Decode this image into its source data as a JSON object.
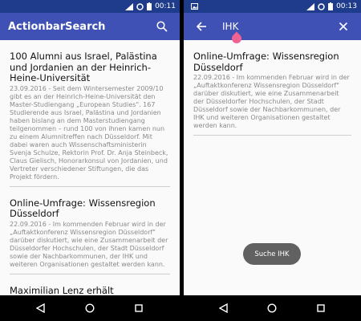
{
  "left": {
    "status": {
      "time": "00:11",
      "network": "4G"
    },
    "appbar": {
      "title": "ActionbarSearch",
      "search_icon": "search-icon"
    },
    "articles": [
      {
        "title": "100 Alumni aus Israel, Palästina und Jordanien an der Heinrich-Heine-Universität",
        "snippet": "23.09.2016 - Seit dem Wintersemester 2009/10 gibt es an der Heinrich-Heine-Universität den Master-Studiengang „European Studies\". 167 Studierende aus Israel, Palästina und Jordanien haben bislang an dem Masterstudiengang teilgenommen – rund 100 von ihnen kamen nun zu einem Alumnitreffen nach Düsseldorf. Mit dabei waren auch Wissenschaftsministerin Svenja Schulze, Rektorin Prof. Dr. Anja Steinbeck, Claus Gielisch, Honorarkonsul von Jordanien, und Vertreter verschiedener Stiftungen, die das Projekt fördern."
      },
      {
        "title": "Online-Umfrage: Wissensregion Düsseldorf",
        "snippet": "22.09.2016 - Im kommenden Februar wird in der „Auftaktkonferenz Wissensregion Düsseldorf\" darüber diskutiert, wie eine Zusammenarbeit der Düsseldorfer Hochschulen, der Stadt Düsseldorf sowie der Nachbarkommunen, der IHK und weiteren Organisationen gestaltet werden kann."
      },
      {
        "title": "Maximilian Lenz erhält Nachwuchspreis der Anatomischen",
        "snippet": ""
      }
    ]
  },
  "right": {
    "status": {
      "time": "00:13",
      "network": "4G"
    },
    "appbar": {
      "query": "IHK",
      "back_icon": "back-arrow-icon",
      "clear_icon": "close-icon"
    },
    "articles": [
      {
        "title": "Online-Umfrage: Wissensregion Düsseldorf",
        "snippet": "22.09.2016 - Im kommenden Februar wird in der „Auftaktkonferenz Wissensregion Düsseldorf\" darüber diskutiert, wie eine Zusammenarbeit der Düsseldorfer Hochschulen, der Stadt Düsseldorf sowie der Nachbarkommunen, der IHK und weiteren Organisationen gestaltet werden kann."
      }
    ],
    "toast": "Suche IHK"
  },
  "colors": {
    "primary": "#3f51b5",
    "status": "#1f3c8c",
    "accent": "#f06292"
  }
}
